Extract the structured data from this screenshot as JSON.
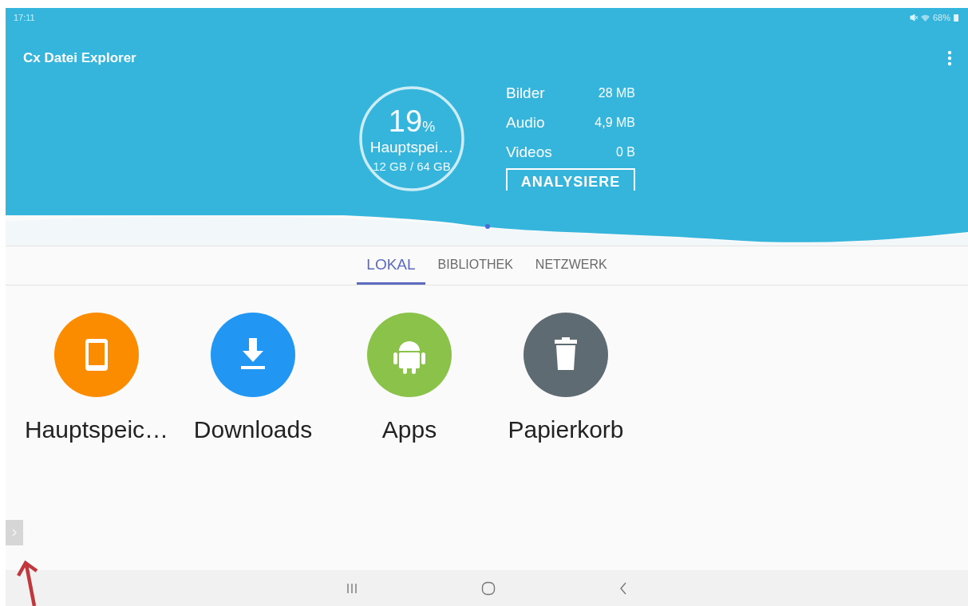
{
  "status_bar": {
    "time": "17:11",
    "battery": "68%"
  },
  "app_bar": {
    "title": "Cx Datei Explorer"
  },
  "storage": {
    "percent": "19",
    "unit": "%",
    "name": "Hauptspei…",
    "usage": "12 GB / 64 GB",
    "categories": [
      {
        "label": "Bilder",
        "size": "28 MB"
      },
      {
        "label": "Audio",
        "size": "4,9 MB"
      },
      {
        "label": "Videos",
        "size": "0 B"
      }
    ],
    "analyze_button": "ANALYSIERE"
  },
  "tabs": [
    {
      "label": "LOKAL",
      "selected": true
    },
    {
      "label": "BIBLIOTHEK",
      "selected": false
    },
    {
      "label": "NETZWERK",
      "selected": false
    }
  ],
  "locations": [
    {
      "label": "Hauptspeic…",
      "kind": "tablet",
      "color": "#fb8c00"
    },
    {
      "label": "Downloads",
      "kind": "download",
      "color": "#2196f3"
    },
    {
      "label": "Apps",
      "kind": "android",
      "color": "#8bc34a"
    },
    {
      "label": "Papierkorb",
      "kind": "trash",
      "color": "#5f6b73"
    }
  ]
}
